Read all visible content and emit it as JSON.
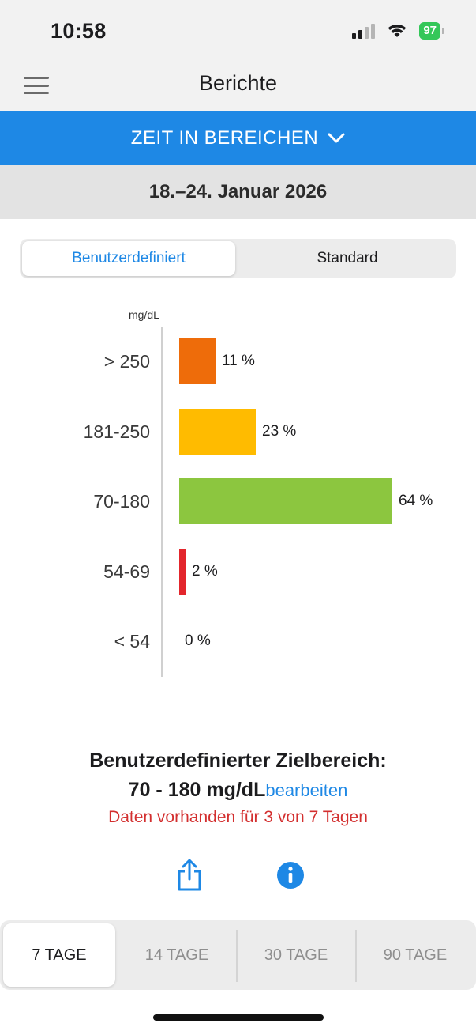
{
  "status_bar": {
    "time": "10:58",
    "battery": "97"
  },
  "nav": {
    "title": "Berichte",
    "menu_icon": "hamburger-icon"
  },
  "report_selector": {
    "label": "ZEIT IN BEREICHEN",
    "icon": "chevron-down-icon"
  },
  "date_range": "18.–24. Januar 2026",
  "segments": [
    {
      "label": "Benutzerdefiniert",
      "selected": true
    },
    {
      "label": "Standard",
      "selected": false
    }
  ],
  "chart_data": {
    "type": "bar",
    "orientation": "horizontal",
    "unit": "mg/dL",
    "categories": [
      "> 250",
      "181-250",
      "70-180",
      "54-69",
      "< 54"
    ],
    "values": [
      11,
      23,
      64,
      2,
      0
    ],
    "value_labels": [
      "11 %",
      "23 %",
      "64 %",
      "2 %",
      "0 %"
    ],
    "colors": [
      "#ee6c0a",
      "#ffbb00",
      "#8cc63f",
      "#e3262c",
      "#cccccc"
    ],
    "xlim": [
      0,
      64
    ]
  },
  "target": {
    "title": "Benutzerdefinierter Zielbereich:",
    "range": "70 - 180 mg/dL",
    "edit_label": "bearbeiten",
    "data_note": "Daten vorhanden für 3 von 7 Tagen"
  },
  "actions": {
    "share_icon": "share-icon",
    "info_icon": "info-icon"
  },
  "period_tabs": [
    {
      "label": "7 TAGE",
      "selected": true
    },
    {
      "label": "14 TAGE",
      "selected": false
    },
    {
      "label": "30 TAGE",
      "selected": false
    },
    {
      "label": "90 TAGE",
      "selected": false
    }
  ],
  "colors": {
    "accent": "#1e88e5",
    "warning_text": "#d32f2f"
  }
}
